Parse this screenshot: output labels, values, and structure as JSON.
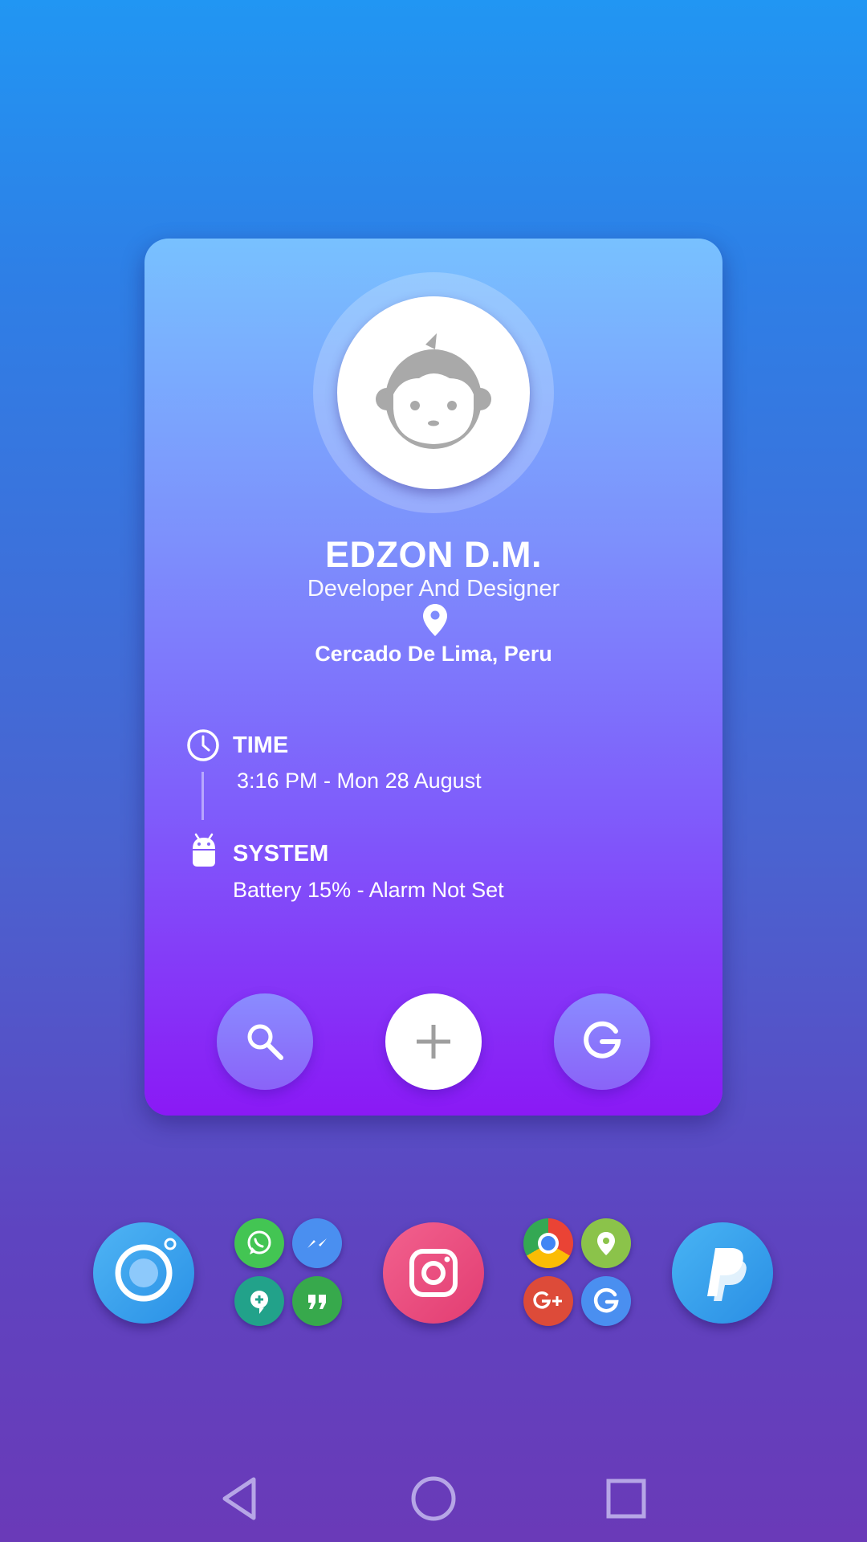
{
  "profile": {
    "name": "EDZON D.M.",
    "role": "Developer And Designer",
    "location": "Cercado De Lima, Peru"
  },
  "info": {
    "time_title": "TIME",
    "time_value": "3:16 PM - Mon 28 August",
    "system_title": "SYSTEM",
    "system_value": "Battery 15% - Alarm Not Set"
  },
  "card_actions": [
    "search-icon",
    "add-icon",
    "google-icon"
  ],
  "dock": {
    "apps": [
      "camera",
      "messaging-folder",
      "instagram",
      "google-folder",
      "paypal"
    ],
    "messaging_folder": [
      "whatsapp",
      "messenger",
      "hangouts",
      "google-allo"
    ],
    "google_folder": [
      "chrome",
      "maps",
      "google-plus",
      "google"
    ]
  },
  "nav": [
    "back-icon",
    "home-icon",
    "recents-icon"
  ],
  "colors": {
    "wallpaper_top": "#2196F3",
    "wallpaper_bottom": "#6a3ab8",
    "card_top": "#78c1ff",
    "card_bottom": "#8a19f5"
  }
}
